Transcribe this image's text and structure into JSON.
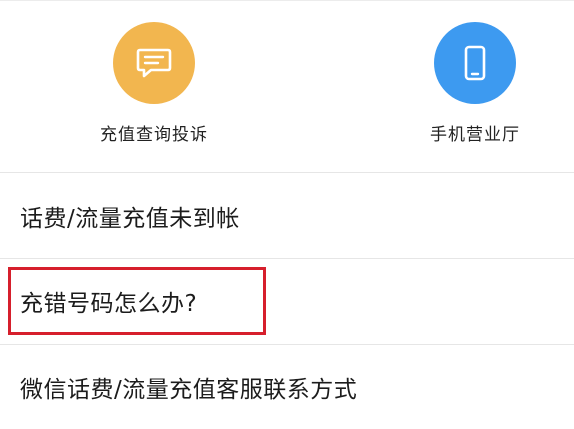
{
  "shortcuts": [
    {
      "label": "充值查询投诉",
      "icon": "chat-bubble-icon",
      "color": "#f2b64f"
    },
    {
      "label": "手机营业厅",
      "icon": "smartphone-icon",
      "color": "#3d9af0"
    }
  ],
  "faq": {
    "items": [
      {
        "label": "话费/流量充值未到帐"
      },
      {
        "label": "充错号码怎么办?"
      },
      {
        "label": "微信话费/流量充值客服联系方式"
      }
    ]
  },
  "colors": {
    "highlight": "#d61f2c"
  }
}
